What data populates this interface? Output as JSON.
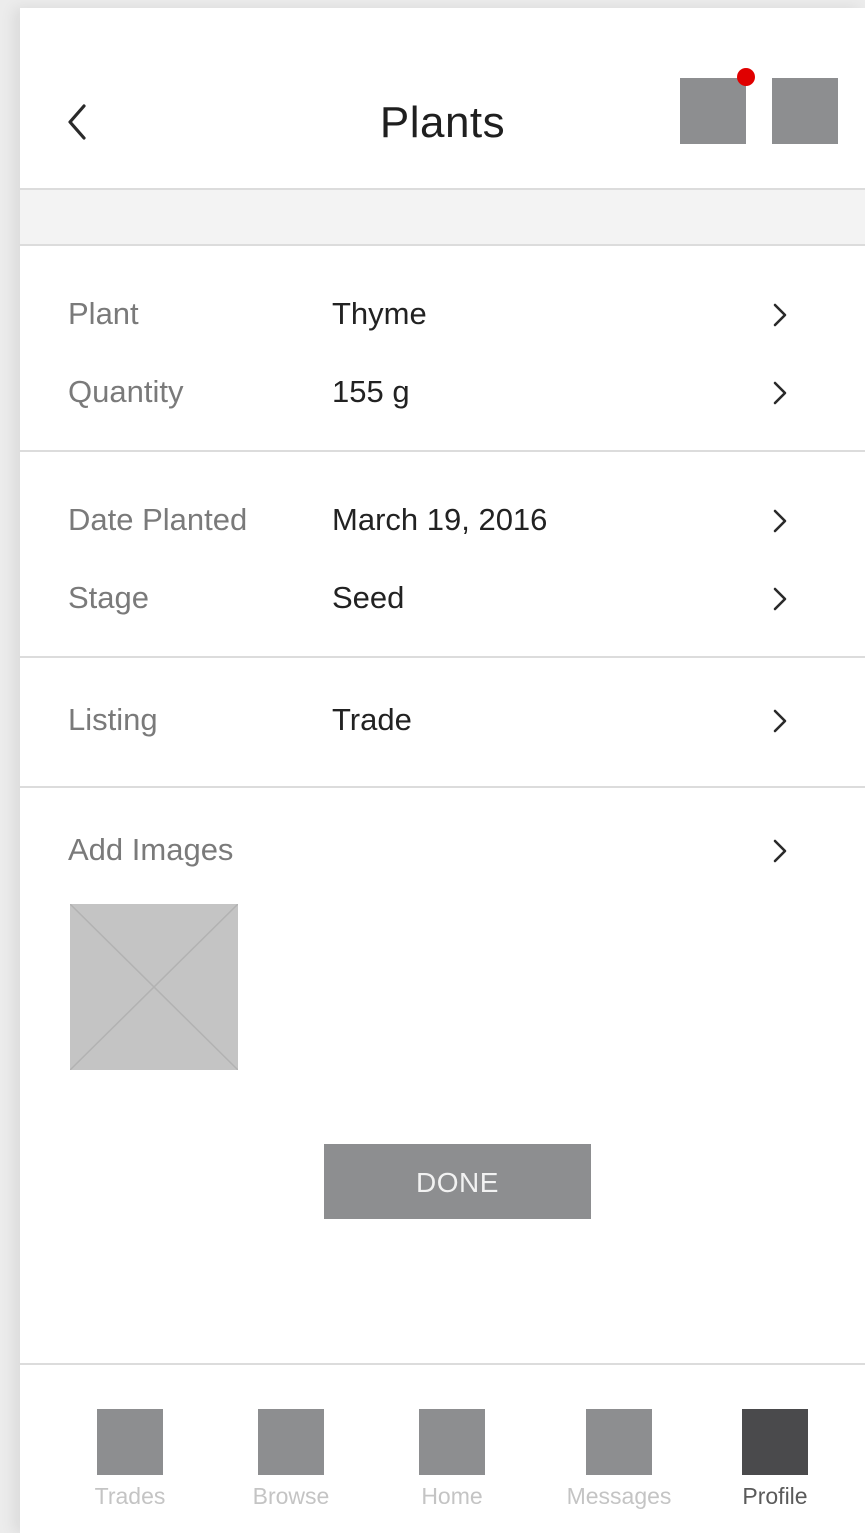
{
  "header": {
    "title": "Plants",
    "back_icon": "chevron-left-icon",
    "notification_color": "#e00000"
  },
  "form": {
    "plant": {
      "label": "Plant",
      "value": "Thyme"
    },
    "quantity": {
      "label": "Quantity",
      "value": "155 g"
    },
    "date_planted": {
      "label": "Date Planted",
      "value": "March 19, 2016"
    },
    "stage": {
      "label": "Stage",
      "value": "Seed"
    },
    "listing": {
      "label": "Listing",
      "value": "Trade"
    },
    "add_images": {
      "label": "Add Images"
    }
  },
  "done_label": "DONE",
  "tabs": {
    "trades": "Trades",
    "browse": "Browse",
    "home": "Home",
    "messages": "Messages",
    "profile": "Profile",
    "active": "Profile"
  },
  "colors": {
    "icon_grey": "#8d8e90",
    "active_tab": "#4a4a4c",
    "placeholder": "#c4c4c4"
  }
}
